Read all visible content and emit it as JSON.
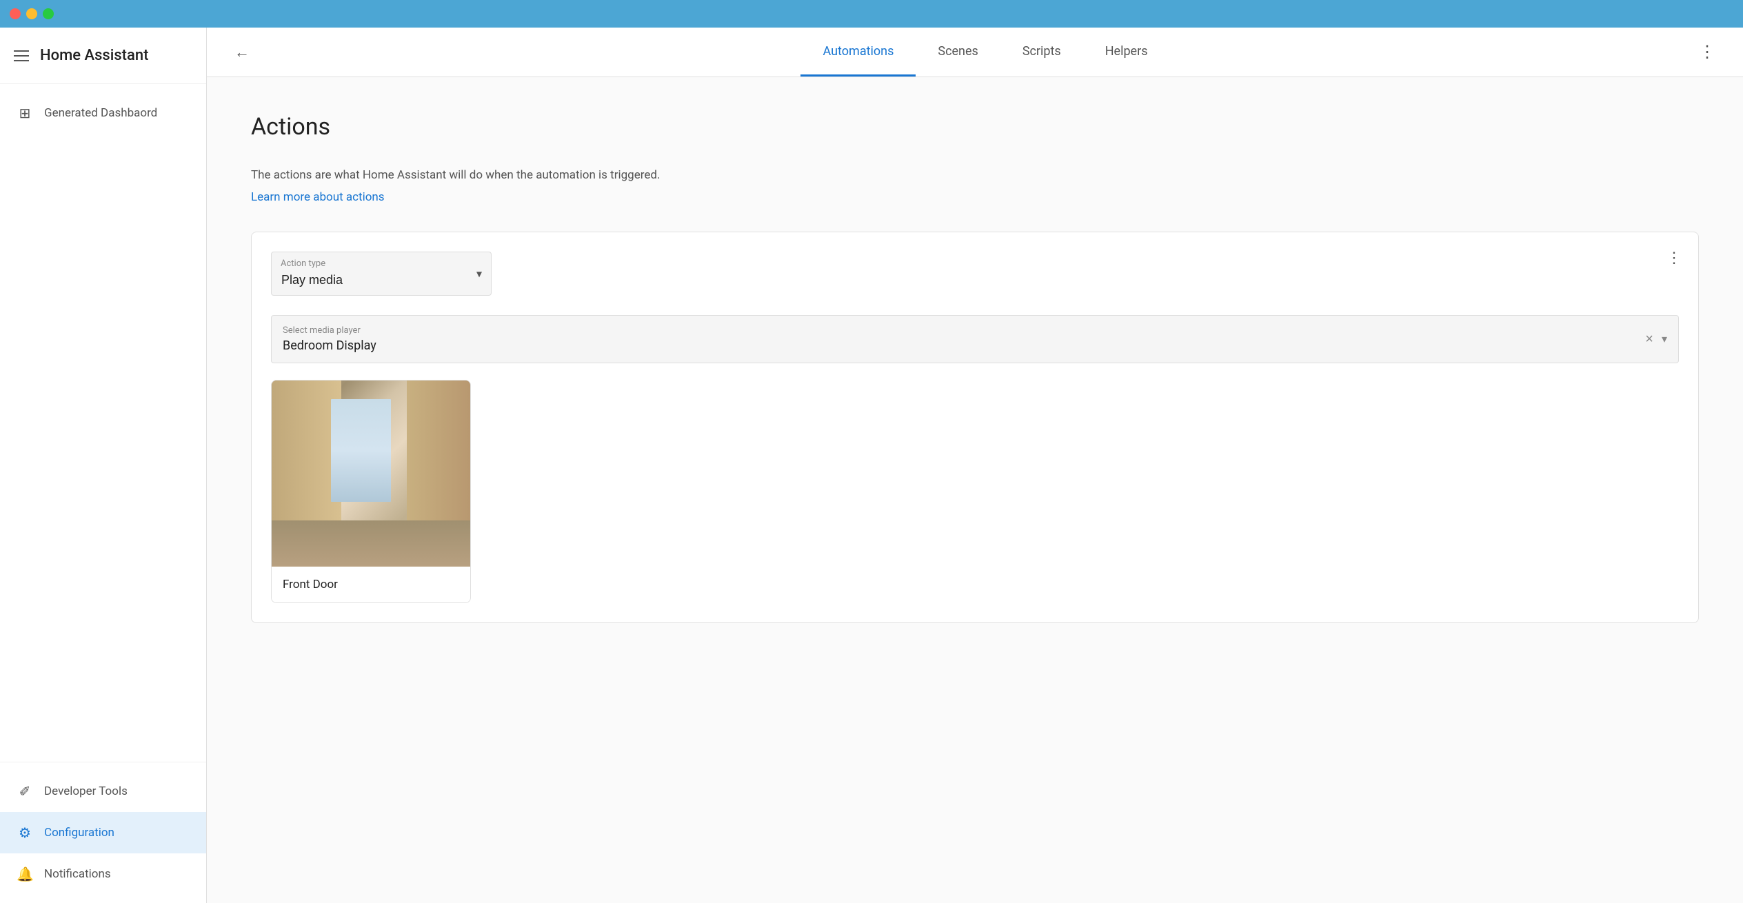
{
  "titlebar": {
    "buttons": [
      "close",
      "minimize",
      "maximize"
    ]
  },
  "sidebar": {
    "title": "Home Assistant",
    "nav_items": [
      {
        "id": "dashboard",
        "label": "Generated Dashbaord",
        "icon": "grid"
      },
      {
        "id": "developer-tools",
        "label": "Developer Tools",
        "icon": "wrench"
      },
      {
        "id": "configuration",
        "label": "Configuration",
        "icon": "gear",
        "active": true
      },
      {
        "id": "notifications",
        "label": "Notifications",
        "icon": "bell"
      }
    ]
  },
  "topnav": {
    "back_label": "←",
    "tabs": [
      {
        "id": "automations",
        "label": "Automations",
        "active": true
      },
      {
        "id": "scenes",
        "label": "Scenes"
      },
      {
        "id": "scripts",
        "label": "Scripts"
      },
      {
        "id": "helpers",
        "label": "Helpers"
      }
    ],
    "more_label": "⋮"
  },
  "content": {
    "title": "Actions",
    "description": "The actions are what Home Assistant will do when the automation is triggered.",
    "learn_more": "Learn more about actions",
    "action_card": {
      "action_type_label": "Action type",
      "action_type_value": "Play media",
      "media_player_label": "Select media player",
      "media_player_value": "Bedroom Display",
      "media_thumbnail_label": "Front Door",
      "more_label": "⋮",
      "clear_label": "×",
      "expand_label": "▾"
    }
  },
  "colors": {
    "accent": "#1976d2",
    "active_bg": "#e3f0fb",
    "titlebar": "#4ca6d4"
  }
}
